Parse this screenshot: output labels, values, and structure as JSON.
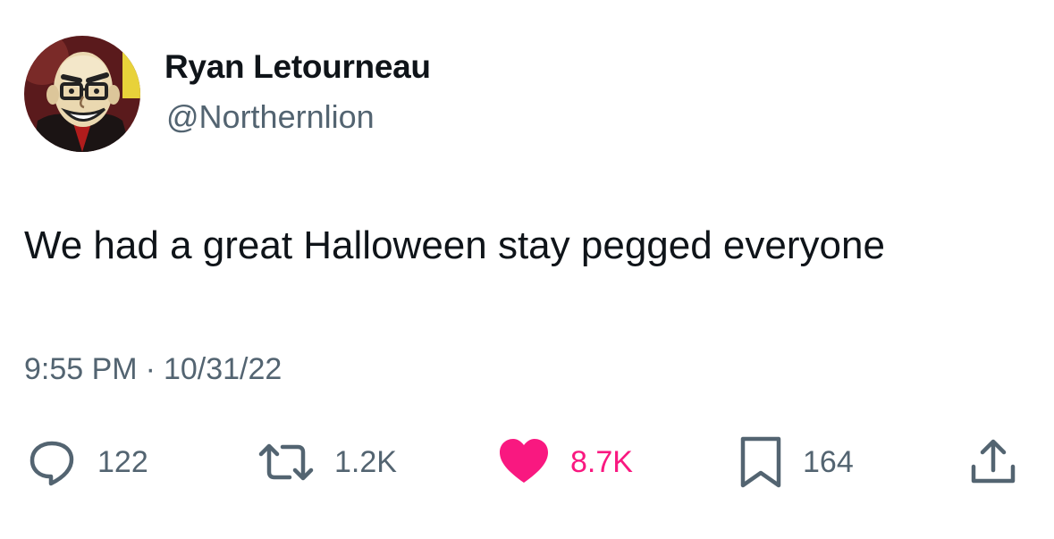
{
  "author": {
    "name": "Ryan Letourneau",
    "handle": "@Northernlion"
  },
  "tweet": {
    "text": "We had a great Halloween stay pegged everyone",
    "time": "9:55 PM",
    "separator": "·",
    "date": "10/31/22"
  },
  "actions": {
    "replies": "122",
    "retweets": "1.2K",
    "likes": "8.7K",
    "bookmarks": "164"
  },
  "icons": {
    "reply": "reply-bubble-icon",
    "retweet": "retweet-icon",
    "like": "heart-icon",
    "bookmark": "bookmark-icon",
    "share": "share-icon"
  },
  "colors": {
    "text_primary": "#0f1419",
    "text_secondary": "#536471",
    "like_active": "#f91880"
  }
}
